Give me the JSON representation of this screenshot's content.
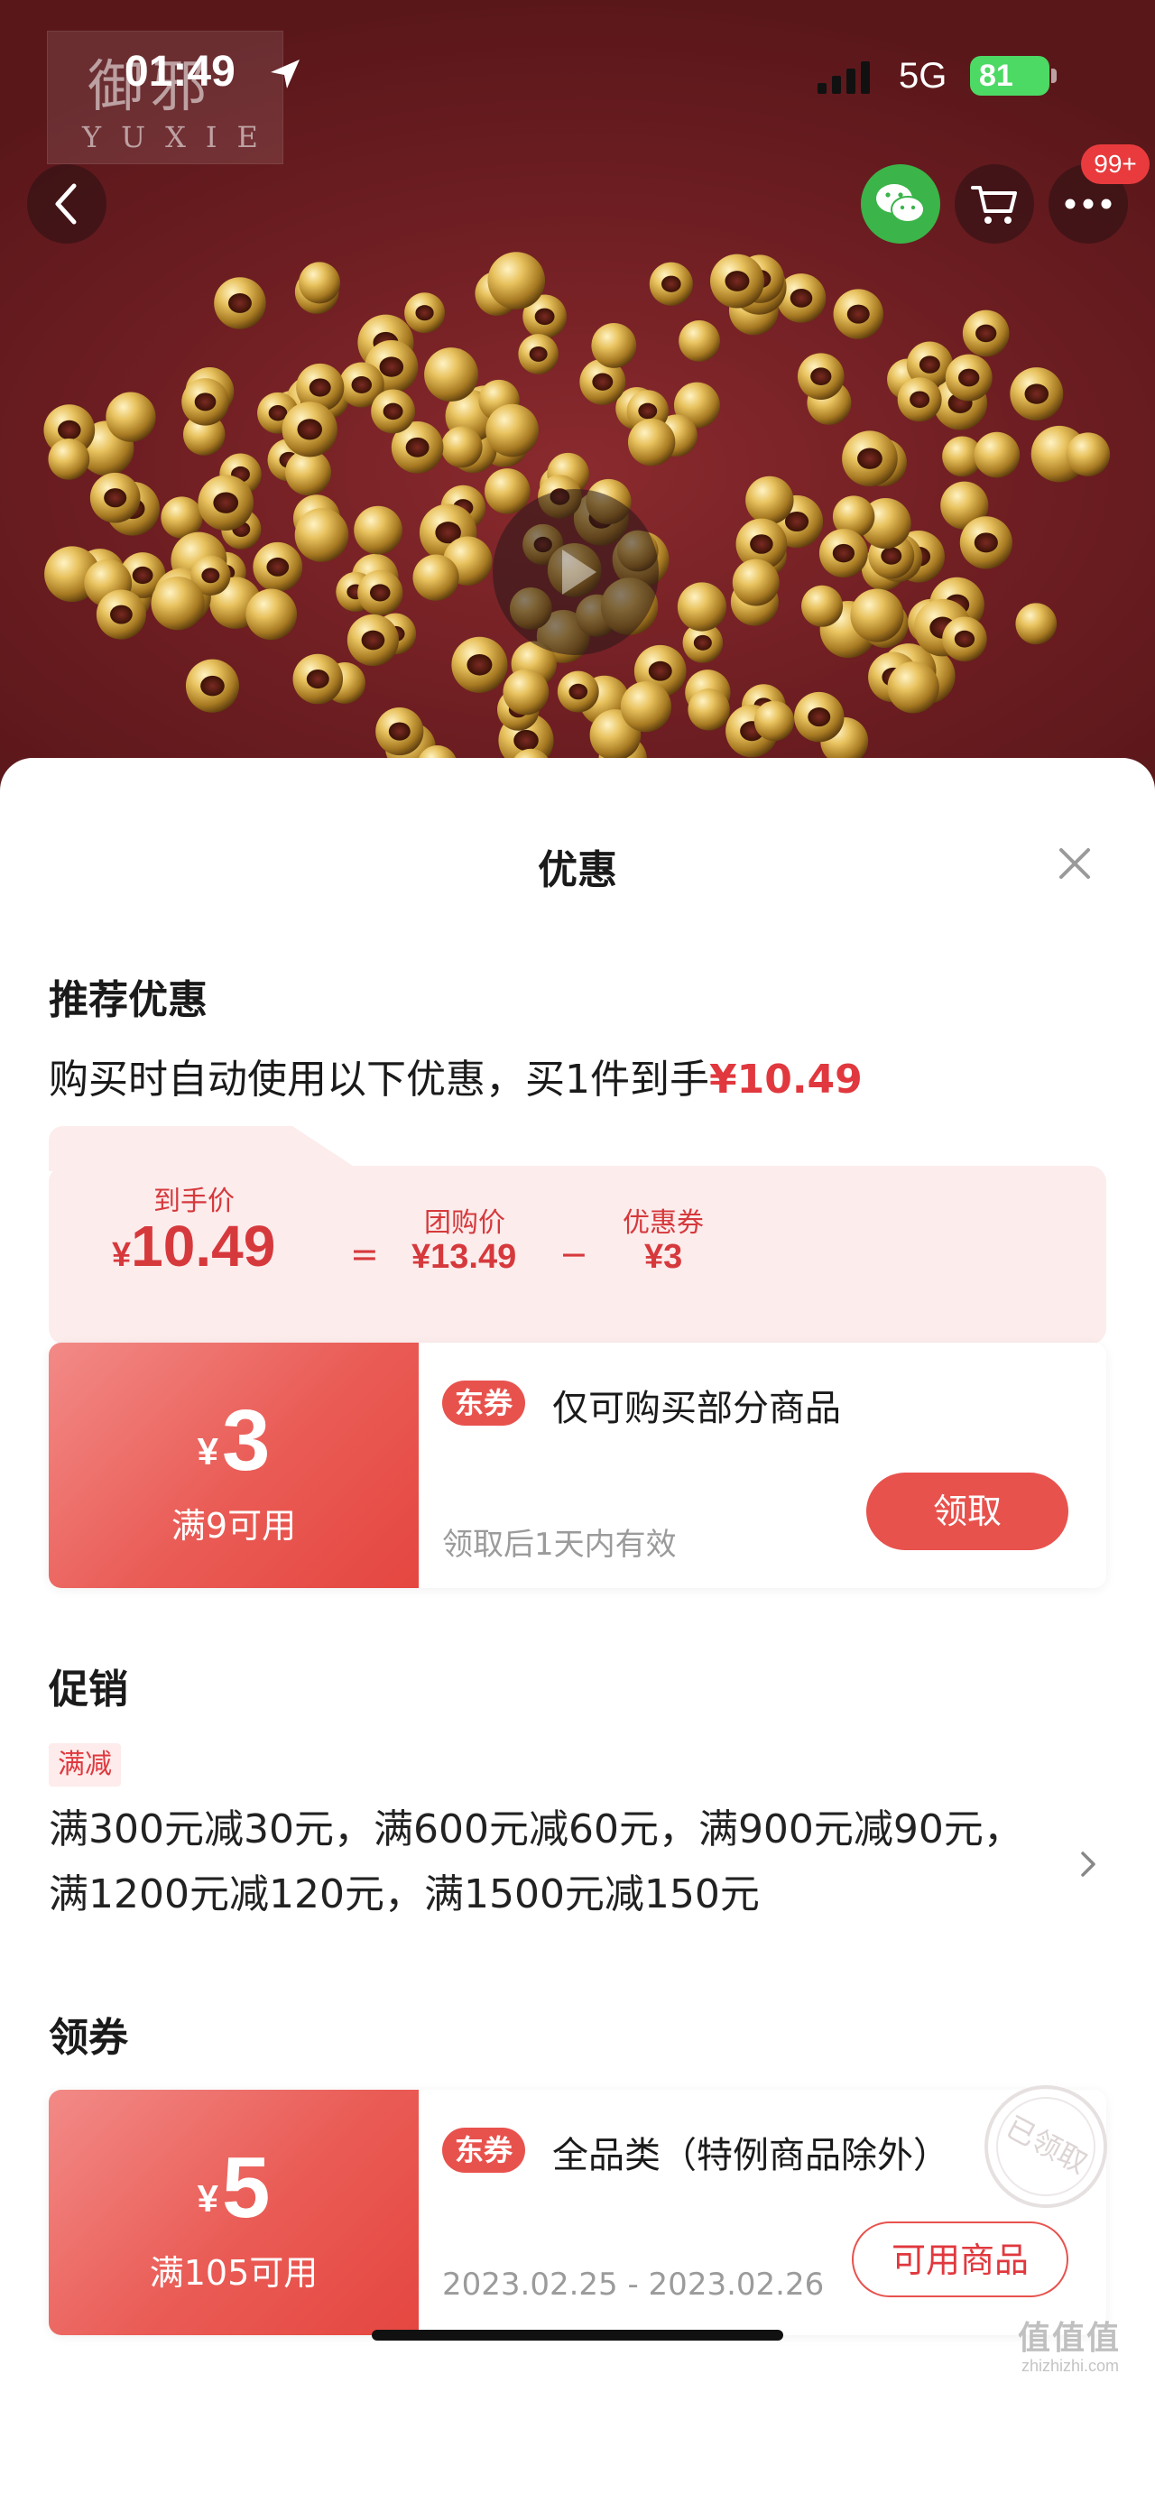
{
  "status_bar": {
    "time": "01:49",
    "network": "5G",
    "battery": "81"
  },
  "brand": {
    "logo_cn": "御邪",
    "logo_en": "YUXIE"
  },
  "header": {
    "notification_badge": "99+"
  },
  "sheet": {
    "title": "优惠",
    "recommended": {
      "heading": "推荐优惠",
      "desc_prefix": "购买时自动使用以下优惠，买1件到手",
      "desc_price": "¥10.49",
      "final_label": "到手价",
      "final_currency": "¥",
      "final_price": "10.49",
      "equals": "=",
      "group_label": "团购价",
      "group_price": "¥13.49",
      "minus": "−",
      "coupon_label": "优惠券",
      "coupon_value": "¥3"
    },
    "coupon1": {
      "currency": "¥",
      "amount": "3",
      "condition": "满9可用",
      "tag": "东券",
      "title": "仅可购买部分商品",
      "validity": "领取后1天内有效",
      "button": "领取"
    },
    "promotion": {
      "heading": "促销",
      "tag": "满减",
      "text": "满300元减30元，满600元减60元，满900元减90元，满1200元减120元，满1500元减150元"
    },
    "claim_section": {
      "heading": "领券",
      "coupon": {
        "currency": "¥",
        "amount": "5",
        "condition": "满105可用",
        "tag": "东券",
        "title": "全品类（特例商品除外）",
        "validity": "2023.02.25 - 2023.02.26",
        "button": "可用商品",
        "stamp": "已领取"
      }
    }
  },
  "watermark": {
    "main": "值值值",
    "sub": "zhizhizhi.com"
  },
  "colors": {
    "accent": "#e0383e",
    "coupon_gradient_start": "#f28a87",
    "coupon_gradient_end": "#e54640",
    "hero_bg": "#6e1e22"
  }
}
